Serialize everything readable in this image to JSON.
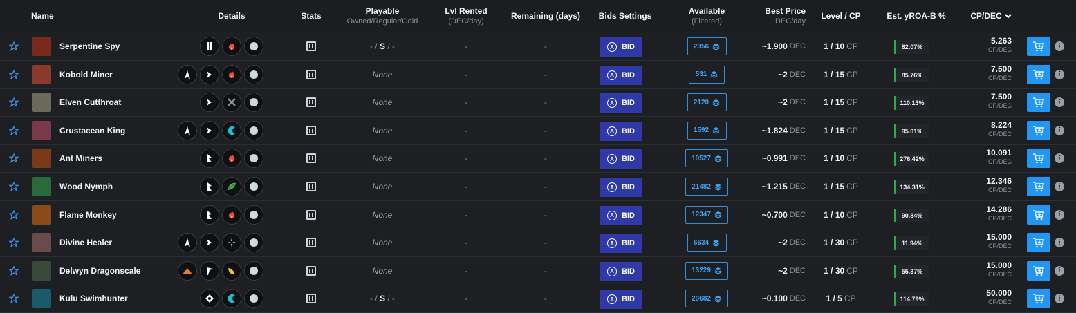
{
  "header": {
    "name": "Name",
    "details": "Details",
    "stats": "Stats",
    "playable": "Playable",
    "playable_sub": "Owned/Regular/Gold",
    "lvl_rented": "Lvl Rented",
    "lvl_rented_sub": "(DEC/day)",
    "remaining": "Remaining (days)",
    "bids_settings": "Bids Settings",
    "available": "Available",
    "available_sub": "(Filtered)",
    "best_price": "Best Price",
    "best_price_sub": "DEC/day",
    "level_cp": "Level / CP",
    "est_yroa": "Est. yROA-B %",
    "cp_dec": "CP/DEC"
  },
  "labels": {
    "bid": "BID",
    "dec": "DEC",
    "cp": "CP",
    "cp_per_dec": "CP/DEC",
    "dash": "-",
    "info": "i"
  },
  "colors": {
    "accent_blue": "#2196f3",
    "bid_button": "#2f3aa8",
    "roa_bar": "#2eab4a"
  },
  "rows": [
    {
      "name": "Serpentine Spy",
      "avatar": "#7a2a1a",
      "details": [
        "melee-icon",
        "fire-element-icon",
        "neutral-icon"
      ],
      "playable_parts": [
        "- /",
        "S",
        "/ -"
      ],
      "lvl_rented": "-",
      "remaining": "-",
      "available": "2356",
      "best_price": "~1.900",
      "level": "1 / 10",
      "roa": "82.07%",
      "cpdec": "5.263"
    },
    {
      "name": "Kobold Miner",
      "avatar": "#8a3a2a",
      "details": [
        "attack-icon",
        "sneak-icon",
        "fire-element-icon",
        "neutral-icon"
      ],
      "playable": "None",
      "lvl_rented": "-",
      "remaining": "-",
      "available": "531",
      "best_price": "~2",
      "level": "1 / 15",
      "roa": "85.76%",
      "cpdec": "7.500"
    },
    {
      "name": "Elven Cutthroat",
      "avatar": "#6a6a5a",
      "details": [
        "sneak-icon",
        "neutral-element-icon",
        "neutral-icon"
      ],
      "playable": "None",
      "lvl_rented": "-",
      "remaining": "-",
      "available": "2120",
      "best_price": "~2",
      "level": "1 / 15",
      "roa": "110.13%",
      "cpdec": "7.500"
    },
    {
      "name": "Crustacean King",
      "avatar": "#7a3a4a",
      "details": [
        "attack-icon",
        "sneak-icon",
        "water-element-icon",
        "neutral-icon"
      ],
      "playable": "None",
      "lvl_rented": "-",
      "remaining": "-",
      "available": "1592",
      "best_price": "~1.824",
      "level": "1 / 15",
      "roa": "95.01%",
      "cpdec": "8.224"
    },
    {
      "name": "Ant Miners",
      "avatar": "#7a3a1a",
      "details": [
        "reach-icon",
        "fire-element-icon",
        "neutral-icon"
      ],
      "playable": "None",
      "lvl_rented": "-",
      "remaining": "-",
      "available": "19527",
      "best_price": "~0.991",
      "level": "1 / 10",
      "roa": "276.42%",
      "cpdec": "10.091"
    },
    {
      "name": "Wood Nymph",
      "avatar": "#2a6a3a",
      "details": [
        "reach-icon",
        "earth-element-icon",
        "neutral-icon"
      ],
      "playable": "None",
      "lvl_rented": "-",
      "remaining": "-",
      "available": "21482",
      "best_price": "~1.215",
      "level": "1 / 15",
      "roa": "134.31%",
      "cpdec": "12.346"
    },
    {
      "name": "Flame Monkey",
      "avatar": "#8a4a1a",
      "details": [
        "reach-icon",
        "fire-element-icon",
        "neutral-icon"
      ],
      "playable": "None",
      "lvl_rented": "-",
      "remaining": "-",
      "available": "12347",
      "best_price": "~0.700",
      "level": "1 / 10",
      "roa": "90.84%",
      "cpdec": "14.286"
    },
    {
      "name": "Divine Healer",
      "avatar": "#6a4a4a",
      "details": [
        "attack-icon",
        "sneak-icon",
        "life-element-icon",
        "neutral-icon"
      ],
      "playable": "None",
      "lvl_rented": "-",
      "remaining": "-",
      "available": "6634",
      "best_price": "~2",
      "level": "1 / 30",
      "roa": "11.94%",
      "cpdec": "15.000"
    },
    {
      "name": "Delwyn Dragonscale",
      "avatar": "#3a4a3a",
      "details": [
        "fire-ability-icon",
        "ranged-icon",
        "dragon-element-icon",
        "neutral-icon"
      ],
      "playable": "None",
      "lvl_rented": "-",
      "remaining": "-",
      "available": "13229",
      "best_price": "~2",
      "level": "1 / 30",
      "roa": "55.37%",
      "cpdec": "15.000"
    },
    {
      "name": "Kulu Swimhunter",
      "avatar": "#1a5a6a",
      "details": [
        "magic-icon",
        "water-element-icon",
        "neutral-icon"
      ],
      "playable_parts": [
        "- /",
        "S",
        "/ -"
      ],
      "lvl_rented": "-",
      "remaining": "-",
      "available": "20682",
      "best_price": "~0.100",
      "level": "1 / 5",
      "roa": "114.79%",
      "cpdec": "50.000"
    }
  ]
}
